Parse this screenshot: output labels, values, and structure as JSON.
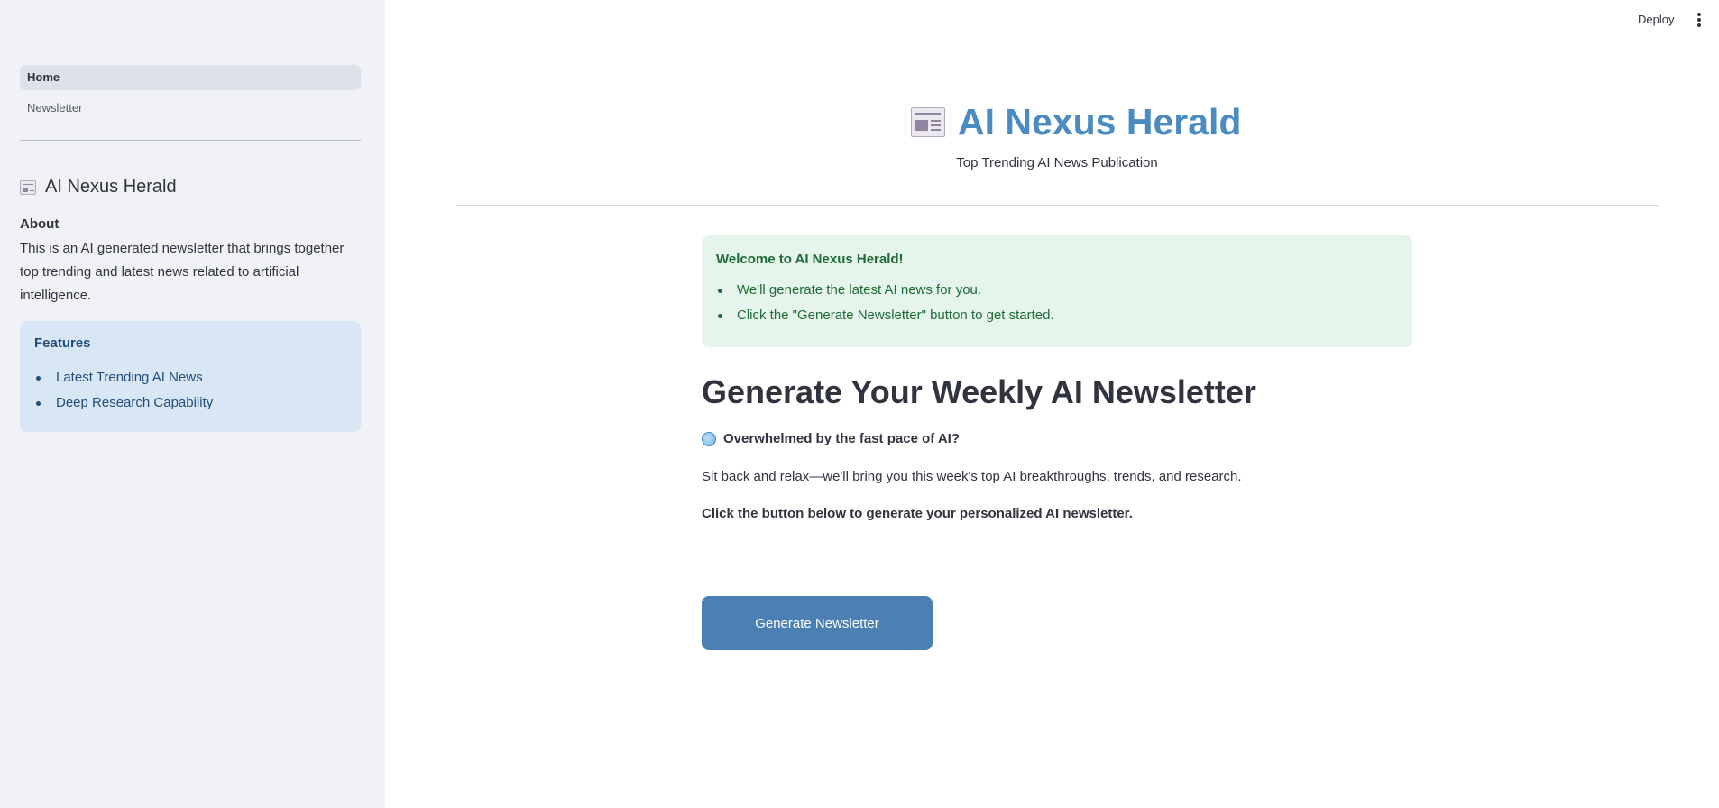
{
  "header": {
    "deploy_label": "Deploy",
    "menu_icon": "kebab-menu-icon"
  },
  "sidebar": {
    "nav": [
      {
        "label": "Home",
        "active": true
      },
      {
        "label": "Newsletter",
        "active": false
      }
    ],
    "title": "AI Nexus Herald",
    "title_icon": "newspaper-icon",
    "about_label": "About",
    "about_text": "This is an AI generated newsletter that brings together top trending and latest news related to artificial intelligence.",
    "features": {
      "title": "Features",
      "items": [
        "Latest Trending AI News",
        "Deep Research Capability"
      ]
    }
  },
  "main": {
    "title": "AI Nexus Herald",
    "title_icon": "newspaper-icon",
    "subtitle": "Top Trending AI News Publication",
    "welcome": {
      "title": "Welcome to AI Nexus Herald!",
      "items": [
        "We'll generate the latest AI news for you.",
        "Click the \"Generate Newsletter\" button to get started."
      ]
    },
    "heading": "Generate Your Weekly AI Newsletter",
    "overwhelmed_icon": "globe-icon",
    "overwhelmed_text": "Overwhelmed by the fast pace of AI?",
    "relax_text": "Sit back and relax—we'll bring you this week's top AI breakthroughs, trends, and research.",
    "click_text": "Click the button below to generate your personalized AI newsletter.",
    "button_label": "Generate Newsletter"
  },
  "colors": {
    "sidebar_bg": "#f0f2f6",
    "title_blue": "#4a8bc2",
    "success_bg": "#e6f5eb",
    "success_text": "#1e6b36",
    "info_bg": "#d9e6f5",
    "info_text": "#1f4e7a",
    "button_bg": "#4a80b3"
  }
}
